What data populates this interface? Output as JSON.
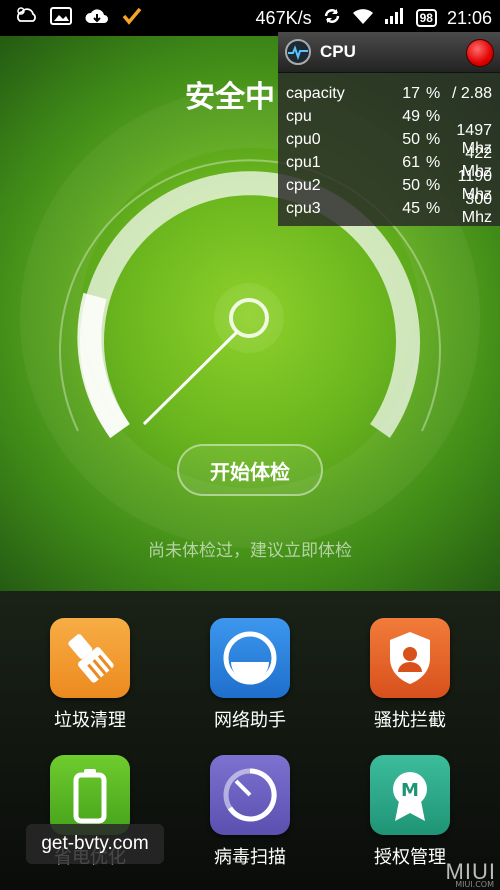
{
  "status_bar": {
    "network_speed": "467K/s",
    "battery": "98",
    "time": "21:06"
  },
  "hero": {
    "title": "安全中",
    "start_button": "开始体检",
    "hint": "尚未体检过，建议立即体检"
  },
  "cpu_monitor": {
    "title": "CPU",
    "rows": [
      {
        "name": "capacity",
        "pct": "17",
        "unit": "%",
        "extra": "/ 2.88"
      },
      {
        "name": "cpu",
        "pct": "49",
        "unit": "%",
        "extra": ""
      },
      {
        "name": "cpu0",
        "pct": "50",
        "unit": "%",
        "extra": "1497 Mhz"
      },
      {
        "name": "cpu1",
        "pct": "61",
        "unit": "%",
        "extra": "422 Mhz"
      },
      {
        "name": "cpu2",
        "pct": "50",
        "unit": "%",
        "extra": "1190 Mhz"
      },
      {
        "name": "cpu3",
        "pct": "45",
        "unit": "%",
        "extra": "300 Mhz"
      }
    ]
  },
  "tiles": [
    {
      "label": "垃圾清理",
      "icon": "broom-icon",
      "color": "#f29a2e"
    },
    {
      "label": "网络助手",
      "icon": "network-icon",
      "color": "#2f86e0"
    },
    {
      "label": "骚扰拦截",
      "icon": "shield-person-icon",
      "color": "#e8642a"
    },
    {
      "label": "省电优化",
      "icon": "battery-icon",
      "color": "#5cb82a"
    },
    {
      "label": "病毒扫描",
      "icon": "scan-icon",
      "color": "#6a5fc0"
    },
    {
      "label": "授权管理",
      "icon": "badge-icon",
      "color": "#2fae8c"
    }
  ],
  "watermark": "get-bvty.com",
  "brand": "MIUI",
  "brand_small": "MIUI.COM"
}
